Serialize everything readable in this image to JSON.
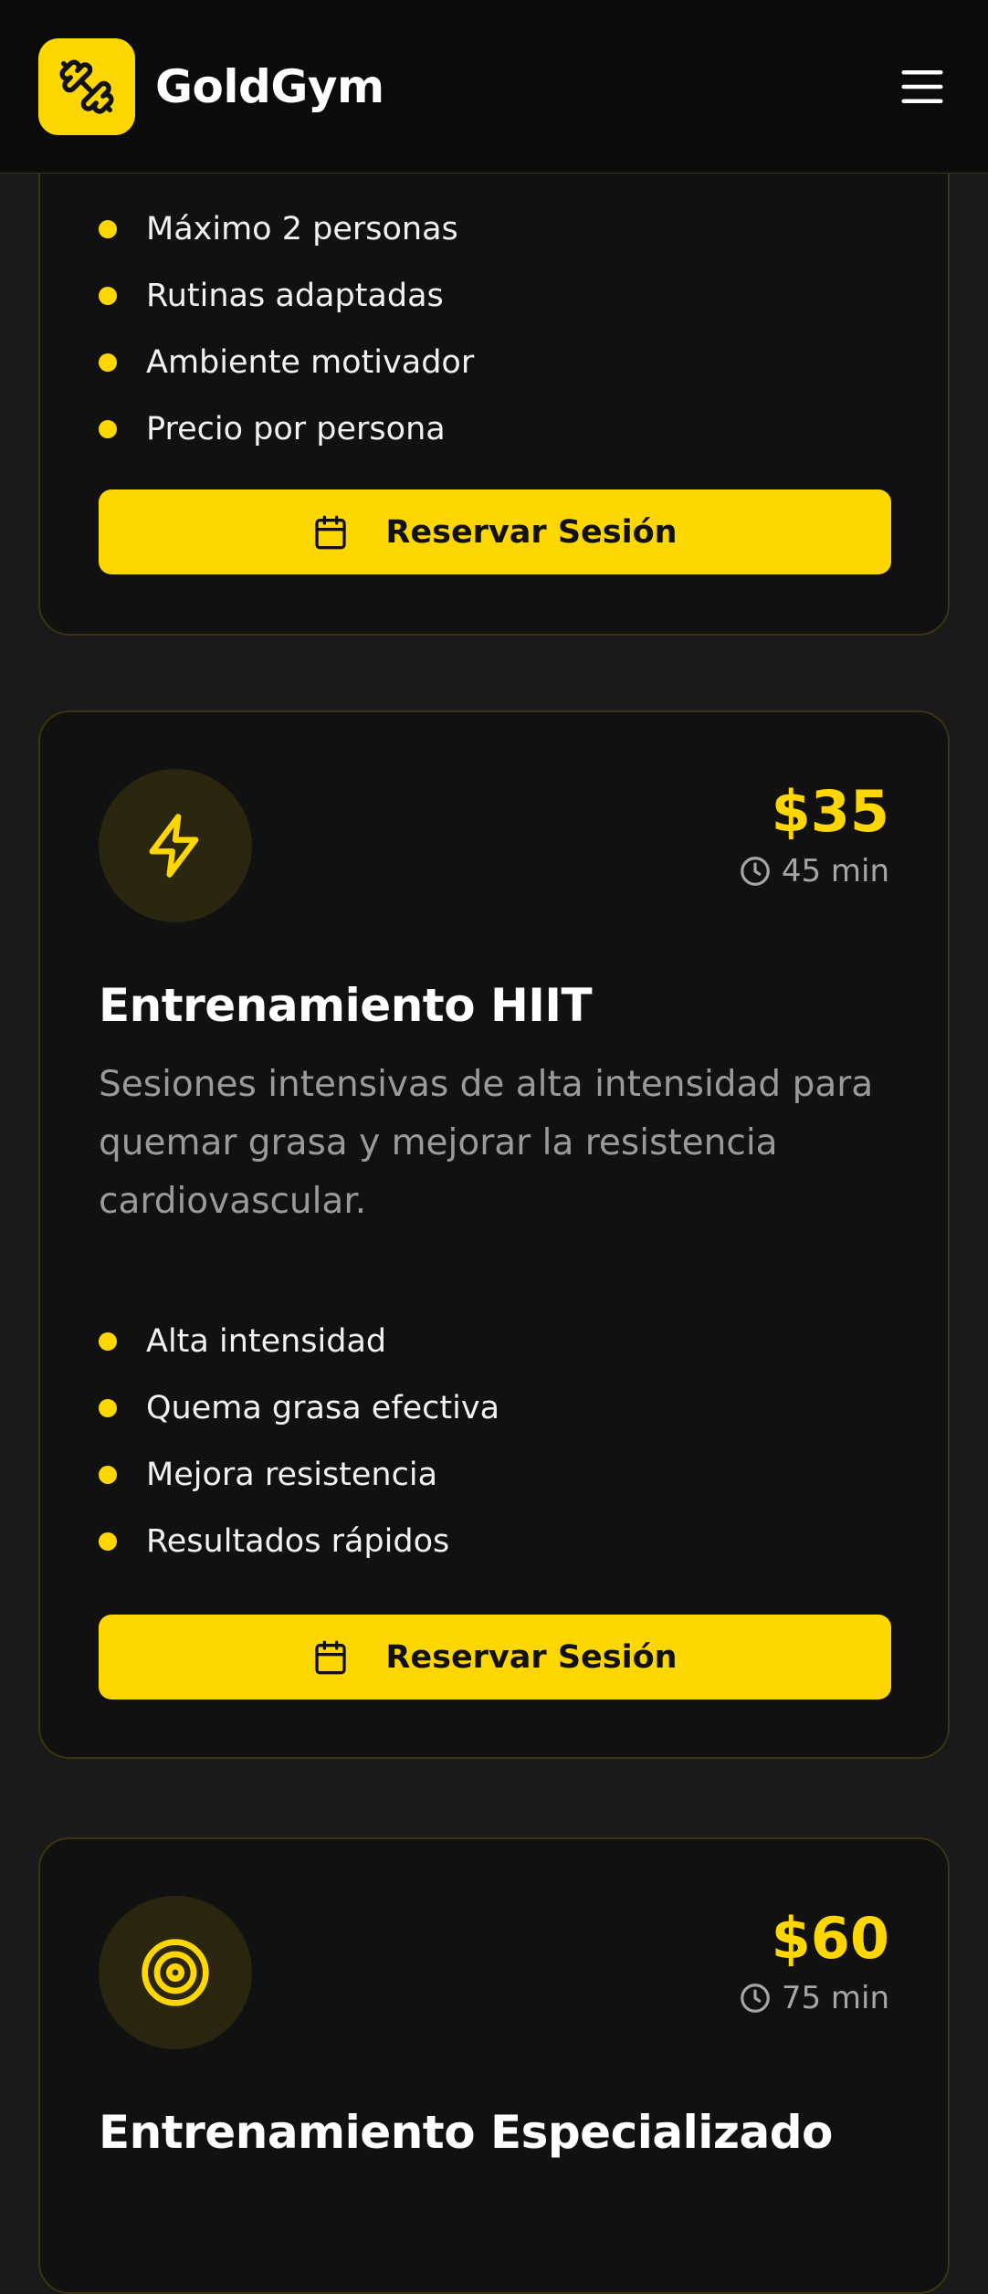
{
  "header": {
    "brand": "GoldGym",
    "logo_icon": "dumbbell-icon",
    "menu_icon": "hamburger-menu-icon"
  },
  "colors": {
    "accent": "#ffd700",
    "background": "#1a1a1a",
    "card": "#111111",
    "muted_text": "#9a9a9a"
  },
  "cards": [
    {
      "features": [
        "Máximo 2 personas",
        "Rutinas adaptadas",
        "Ambiente motivador",
        "Precio por persona"
      ],
      "cta_label": "Reservar Sesión",
      "cta_icon": "calendar-icon"
    },
    {
      "icon": "lightning-icon",
      "price": "$35",
      "duration": "45 min",
      "title": "Entrenamiento HIIT",
      "description": "Sesiones intensivas de alta intensidad para quemar grasa y mejorar la resistencia cardiovascular.",
      "features": [
        "Alta intensidad",
        "Quema grasa efectiva",
        "Mejora resistencia",
        "Resultados rápidos"
      ],
      "cta_label": "Reservar Sesión",
      "cta_icon": "calendar-icon"
    },
    {
      "icon": "target-icon",
      "price": "$60",
      "duration": "75 min",
      "title": "Entrenamiento Especializado"
    }
  ]
}
